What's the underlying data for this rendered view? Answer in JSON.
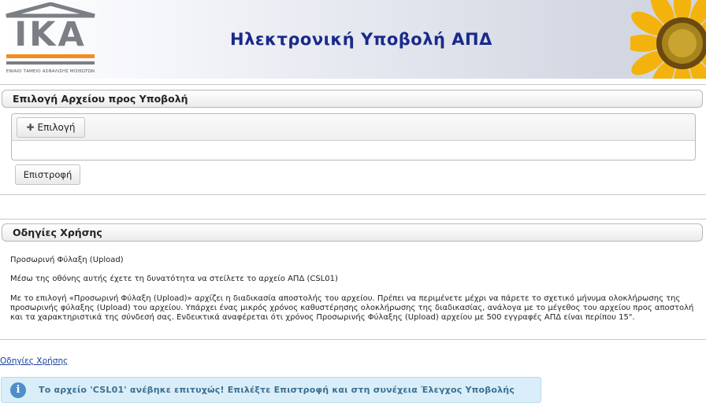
{
  "header": {
    "logo_text": "IKA",
    "logo_subtitle": "ΕΝΙΑΙΟ ΤΑΜΕΙΟ ΑΣΦΑΛΙΣΗΣ ΜΙΣΘΩΤΩΝ",
    "title": "Ηλεκτρονική Υποβολή ΑΠΔ"
  },
  "file_panel": {
    "title": "Επιλογή Αρχείου προς Υποβολή",
    "select_button": "Επιλογή",
    "select_icon": "plus-icon",
    "back_button": "Επιστροφή"
  },
  "instructions_panel": {
    "title": "Οδηγίες Χρήσης",
    "line1": "Προσωρινή Φύλαξη (Upload)",
    "line2": "Μέσω της οθόνης αυτής έχετε τη δυνατότητα να στείλετε το αρχείο ΑΠΔ (CSL01)",
    "line3": "Με το επιλογή «Προσωρινή Φύλαξη (Upload)» αρχίζει η διαδικασία αποστολής του αρχείου. Πρέπει να περιμένετε μέχρι να πάρετε το σχετικό μήνυμα ολοκλήρωσης της προσωρινής φύλαξης (Upload) του αρχείου. Υπάρχει ένας μικρός χρόνος καθυστέρησης ολοκλήρωσης της διαδικασίας, ανάλογα με το μέγεθος του αρχείου προς αποστολή και τα χαρακτηριστικά της σύνδεσή σας. Ενδεικτικά αναφέρεται ότι χρόνος Προσωρινής Φύλαξης (Upload) αρχείου με 500 εγγραφές ΑΠΔ είναι περίπου 15\"."
  },
  "help_link": "Οδηγίες Χρήσης",
  "message": {
    "icon": "info-icon",
    "text": "Το αρχείο 'CSL01' ανέβηκε επιτυχώς! Επιλέξτε Επιστροφή και στη συνέχεια Έλεγχος Υποβολής"
  },
  "colors": {
    "title_blue": "#1a2a8a",
    "logo_orange": "#f28c1e",
    "message_bg": "#d9eef8",
    "message_text": "#3b6f93"
  }
}
